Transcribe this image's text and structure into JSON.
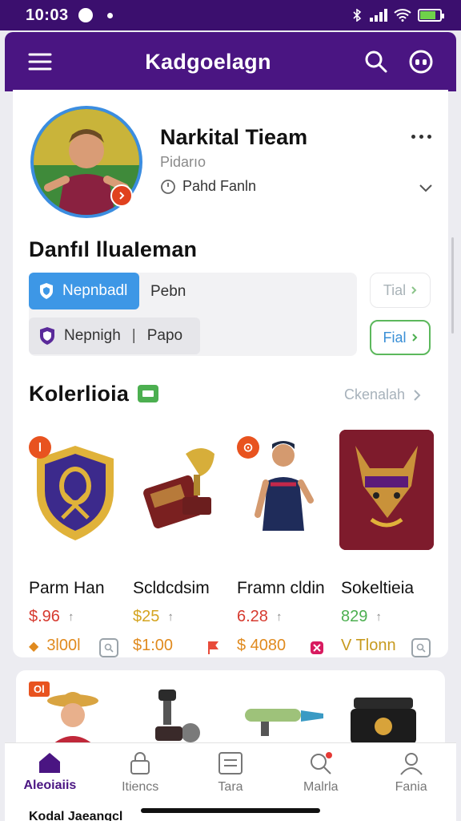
{
  "status_bar": {
    "time": "10:03"
  },
  "app_bar": {
    "title": "Kadgoelagn"
  },
  "profile": {
    "name": "Narkital Tieam",
    "subtitle": "Pidarıo",
    "location": "Pahd Fanln"
  },
  "tags_section": {
    "title": "Danfıl lluaIeman",
    "tag_primary": "Nepnbadl",
    "tag_primary_value": "Pebn",
    "tag_secondary": "Nepnigh",
    "tag_secondary_value": "Papo",
    "pill_faded": "Tial",
    "pill_active": "Fial"
  },
  "collection": {
    "title": "Kolerlioia",
    "see_all": "Ckenalah",
    "items": [
      {
        "name": "Parm Han",
        "price": "$.96",
        "value": "3l00l",
        "badge": "l",
        "price_color": "#d63a2f",
        "value_color": "#e08a1e"
      },
      {
        "name": "Scldcdsim",
        "price": "$25",
        "value": "$1:00",
        "badge": "",
        "price_color": "#d4a420",
        "value_color": "#e08a1e"
      },
      {
        "name": "Framn cldin",
        "price": "6.28",
        "value": "$ 4080",
        "badge": "⊙",
        "price_color": "#d63a2f",
        "value_color": "#e08a1e"
      },
      {
        "name": "Sokeltieia",
        "price": "829",
        "value": "V Tlonn",
        "badge": "",
        "price_color": "#4caf50",
        "value_color": "#c79a1f"
      }
    ]
  },
  "second_card": {
    "badge": "Ol"
  },
  "tab_bar": {
    "tabs": [
      {
        "label": "Aleoiaiis",
        "icon": "home-icon"
      },
      {
        "label": "Itiencs",
        "icon": "lock-icon"
      },
      {
        "label": "Tara",
        "icon": "list-icon"
      },
      {
        "label": "Malrla",
        "icon": "search-icon"
      },
      {
        "label": "Fania",
        "icon": "user-icon"
      }
    ]
  },
  "bottom_peek": "Kodal Jaeangcl"
}
